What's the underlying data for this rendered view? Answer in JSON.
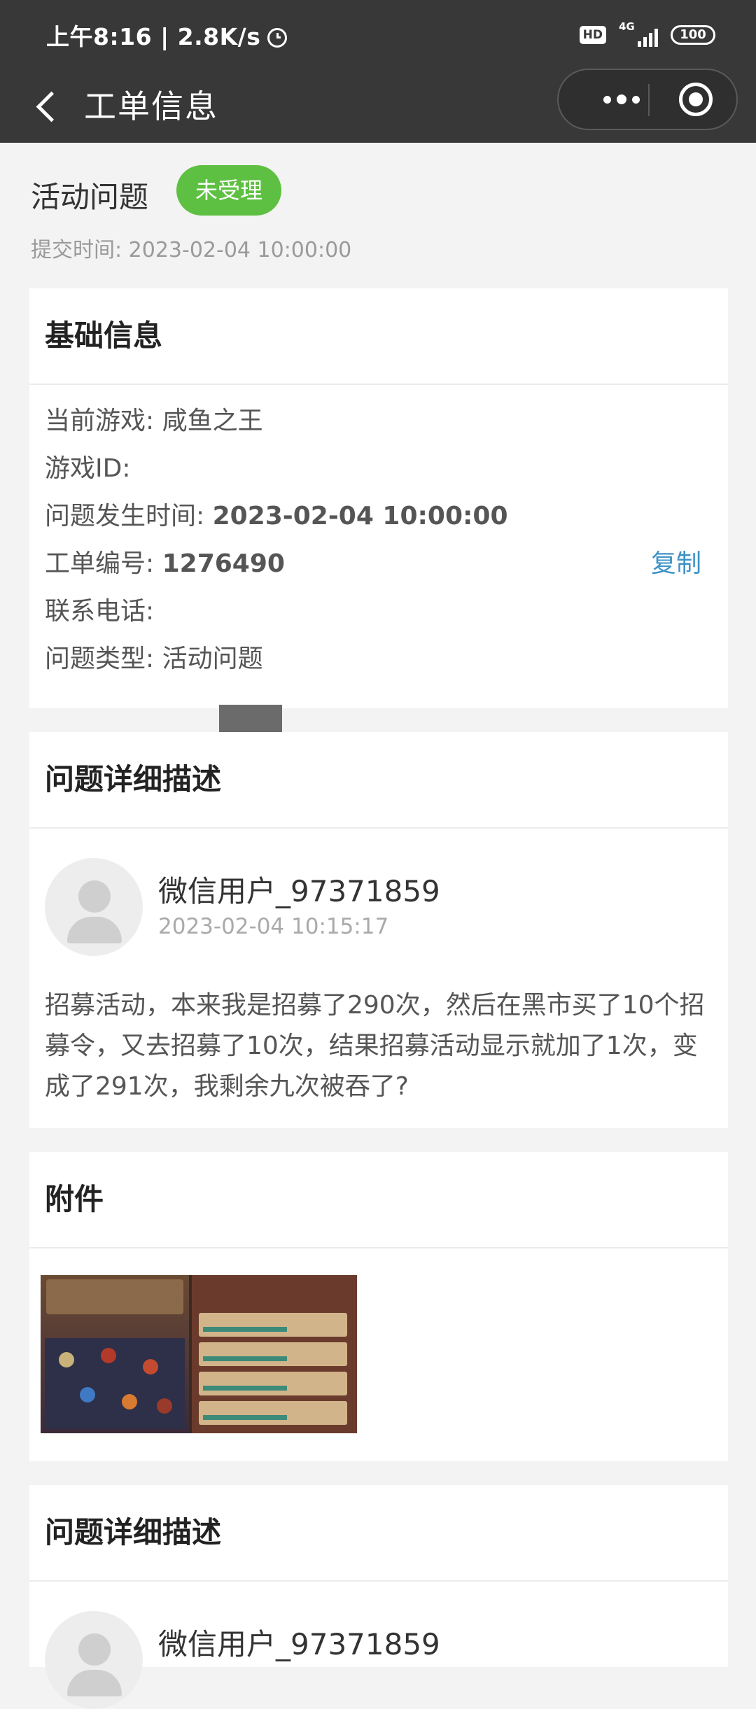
{
  "status_bar": {
    "time_speed": "上午8:16 | 2.8K/s",
    "hd": "HD",
    "network": "4G",
    "battery": "100"
  },
  "nav": {
    "title": "工单信息"
  },
  "ticket": {
    "category": "活动问题",
    "status_badge": "未受理",
    "submit_time": "提交时间: 2023-02-04 10:00:00",
    "status_color": "#5ec042"
  },
  "basic_info": {
    "title": "基础信息",
    "game_label": "当前游戏:",
    "game_value": "咸鱼之王",
    "game_id_label": "游戏ID:",
    "game_id_value": "",
    "occur_time_label": "问题发生时间:",
    "occur_time_value": "2023-02-04 10:00:00",
    "ticket_no_label": "工单编号:",
    "ticket_no_value": "1276490",
    "copy_label": "复制",
    "phone_label": "联系电话:",
    "type_label": "问题类型:",
    "type_value": "活动问题"
  },
  "detail": {
    "title": "问题详细描述",
    "username": "微信用户_97371859",
    "post_time": "2023-02-04 10:15:17",
    "content": "招募活动，本来我是招募了290次，然后在黑市买了10个招募令，又去招募了10次，结果招募活动显示就加了1次，变成了291次，我剩余九次被吞了?"
  },
  "attachment": {
    "title": "附件"
  },
  "detail2": {
    "title": "问题详细描述",
    "username": "微信用户_97371859"
  },
  "colors": {
    "link": "#3d93c6",
    "header_bg": "#383838",
    "page_bg": "#f3f3f3"
  }
}
